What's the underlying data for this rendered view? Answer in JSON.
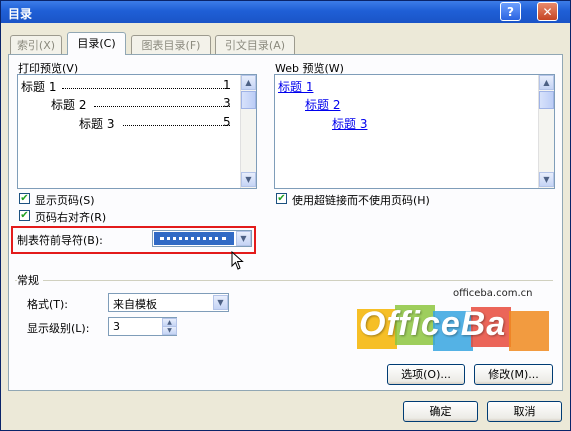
{
  "window": {
    "title": "目录",
    "help_label": "?",
    "close_label": "✕"
  },
  "tabs": [
    {
      "label": "索引(X)",
      "active": false
    },
    {
      "label": "目录(C)",
      "active": true
    },
    {
      "label": "图表目录(F)",
      "active": false
    },
    {
      "label": "引文目录(A)",
      "active": false
    }
  ],
  "print_preview": {
    "label": "打印预览(V)",
    "lines": [
      {
        "text": "标题 1",
        "page": "1"
      },
      {
        "text": "标题 2",
        "page": "3"
      },
      {
        "text": "标题 3",
        "page": "5"
      }
    ]
  },
  "web_preview": {
    "label": "Web 预览(W)",
    "links": [
      "标题 1",
      "标题 2",
      "标题 3"
    ]
  },
  "options": {
    "show_page_numbers": {
      "label": "显示页码(S)",
      "checked": true
    },
    "right_align": {
      "label": "页码右对齐(R)",
      "checked": true
    },
    "use_hyperlinks": {
      "label": "使用超链接而不使用页码(H)",
      "checked": true
    },
    "tab_leader": {
      "label": "制表符前导符(B):",
      "value": "......."
    }
  },
  "general": {
    "title": "常规",
    "format": {
      "label": "格式(T):",
      "value": "来自模板"
    },
    "levels": {
      "label": "显示级别(L):",
      "value": "3"
    }
  },
  "buttons": {
    "options": "选项(O)...",
    "modify": "修改(M)...",
    "ok": "确定",
    "cancel": "取消"
  },
  "watermark": {
    "url": "officeba.com.cn",
    "logo_text": "OfficeBa",
    "tile_colors": [
      "#f5b400",
      "#8dc63f",
      "#36a5e0",
      "#e84a3c",
      "#f08a1e"
    ]
  },
  "icons": {
    "scroll_up": "▲",
    "scroll_down": "▼",
    "dropdown": "▼",
    "check": "✔"
  }
}
